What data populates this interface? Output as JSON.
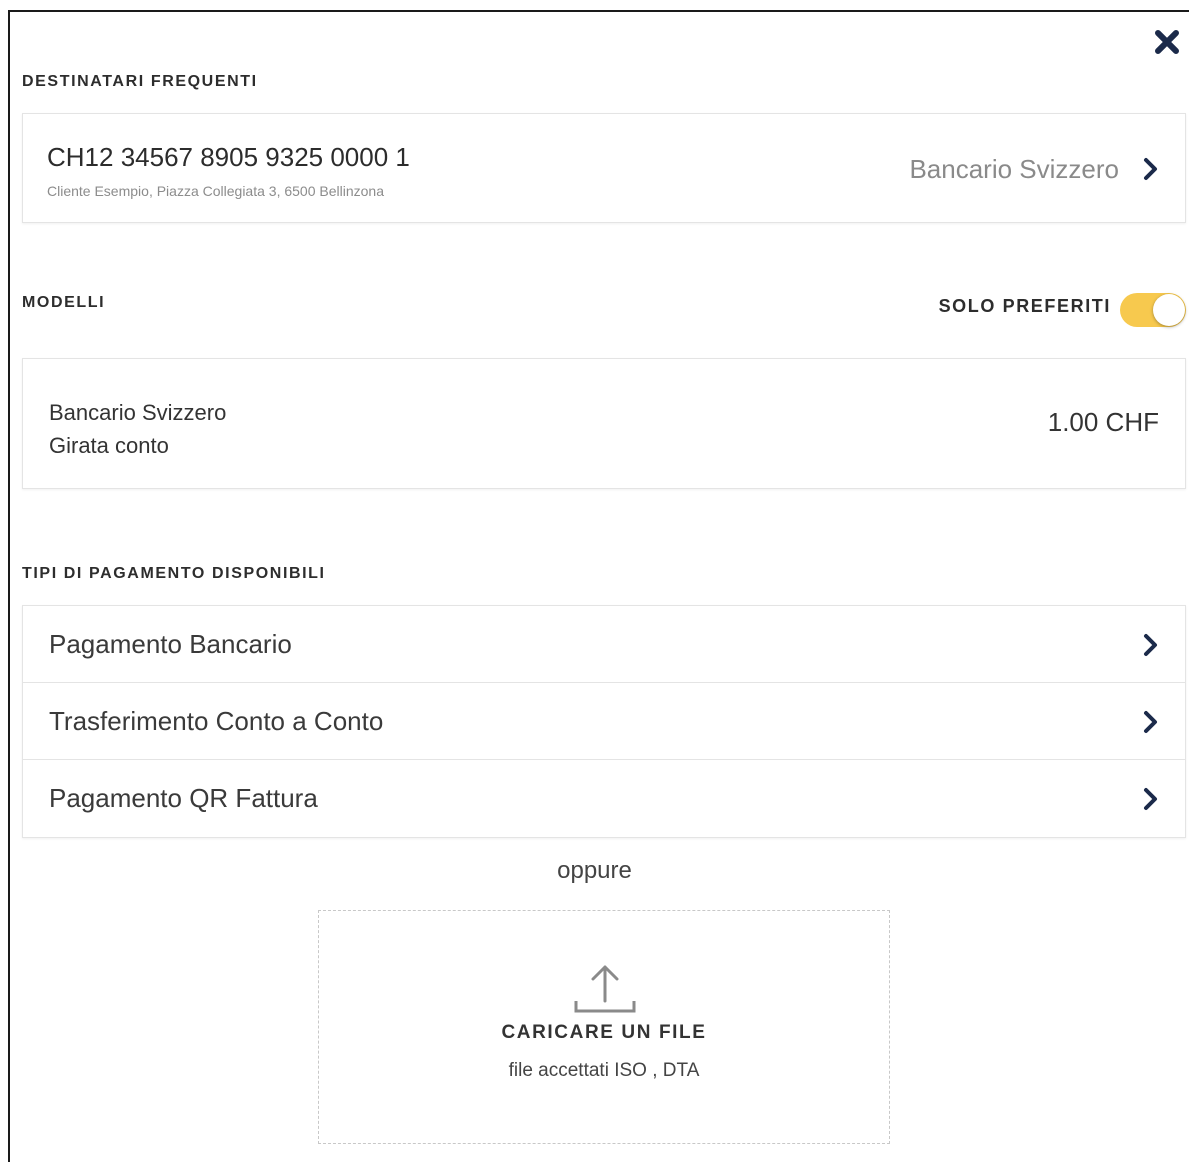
{
  "recipients": {
    "title": "DESTINATARI FREQUENTI",
    "items": [
      {
        "iban": "CH12 34567 8905 9325 0000 1",
        "address": "Cliente Esempio, Piazza Collegiata 3, 6500 Bellinzona",
        "type": "Bancario Svizzero"
      }
    ]
  },
  "templates": {
    "title": "MODELLI",
    "favorites_toggle": {
      "label": "SOLO PREFERITI",
      "on": true,
      "color": "#f7c94e"
    },
    "items": [
      {
        "line1": "Bancario Svizzero",
        "line2": "Girata conto",
        "amount": "1.00 CHF"
      }
    ]
  },
  "payment_types": {
    "title": "TIPI DI PAGAMENTO DISPONIBILI",
    "items": [
      {
        "label": "Pagamento Bancario"
      },
      {
        "label": "Trasferimento Conto a Conto"
      },
      {
        "label": "Pagamento QR Fattura"
      }
    ]
  },
  "separator": "oppure",
  "upload": {
    "title": "CARICARE UN FILE",
    "subtitle": "file accettati ISO , DTA"
  },
  "icons": {
    "close": "close-icon",
    "chevron": "chevron-right-icon",
    "upload": "upload-icon"
  },
  "colors": {
    "accent": "#f7c94e",
    "navy": "#1b2a4a"
  }
}
